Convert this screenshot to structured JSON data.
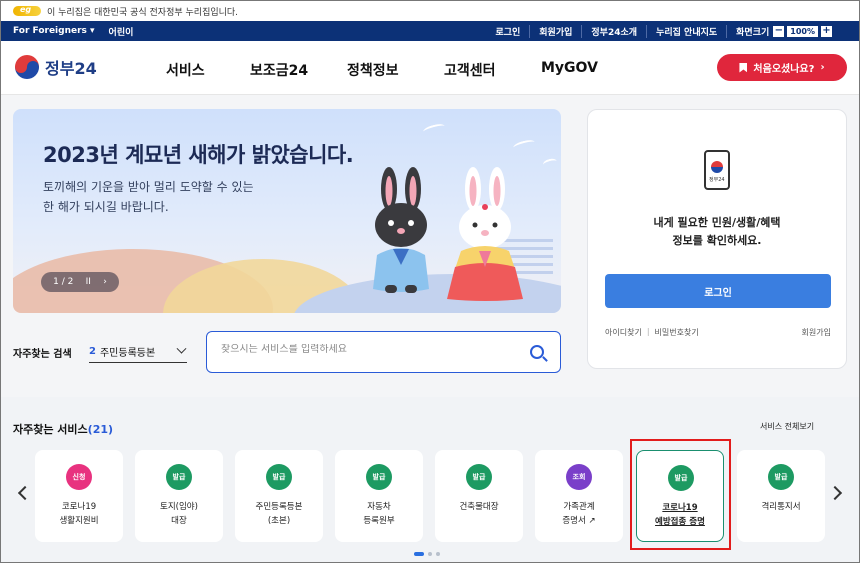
{
  "gov_strip": {
    "text": "이 누리집은 대한민국 공식 전자정부 누리집입니다."
  },
  "util_bar": {
    "for_foreigners": "For Foreigners",
    "kids": "어린이",
    "links": [
      "로그인",
      "회원가입",
      "정부24소개",
      "누리집 안내지도"
    ],
    "zoom_label": "화면크기",
    "zoom_minus": "−",
    "zoom_value": "100%",
    "zoom_plus": "+"
  },
  "header": {
    "logo_text": "정부24",
    "nav": [
      "서비스",
      "보조금24",
      "정책정보",
      "고객센터",
      "MyGOV"
    ],
    "first_visit_button": "처음오셨나요?",
    "first_visit_arrow": "›"
  },
  "banner": {
    "title": "2023년 계묘년 새해가 밝았습니다.",
    "subtitle_line1": "토끼해의 기운을 받아 멀리 도약할 수 있는",
    "subtitle_line2": "한 해가 되시길 바랍니다.",
    "pager": "1 / 2",
    "pager_pause": "II",
    "pager_next": "›"
  },
  "login_card": {
    "phone_text": "정부24",
    "message_line1": "내게 필요한 민원/생활/혜택",
    "message_line2": "정보를 확인하세요.",
    "login_button": "로그인",
    "find_id": "아이디찾기",
    "find_pw": "비밀번호찾기",
    "join": "회원가입"
  },
  "search": {
    "label": "자주찾는 검색",
    "selected_num": "2",
    "selected_value": "주민등록등본",
    "placeholder": "찾으시는 서비스를 입력하세요"
  },
  "services": {
    "title": "자주찾는 서비스",
    "count": "(21)",
    "view_all": "서비스 전체보기",
    "items": [
      {
        "badge": "신청",
        "label": "코로나19\n생활지원비",
        "badge_color": "#e8327f"
      },
      {
        "badge": "발급",
        "label": "토지(임야)\n대장",
        "badge_color": "#1d9a62"
      },
      {
        "badge": "발급",
        "label": "주민등록등본\n(초본)",
        "badge_color": "#1d9a62"
      },
      {
        "badge": "발급",
        "label": "자동차\n등록원부",
        "badge_color": "#1d9a62"
      },
      {
        "badge": "발급",
        "label": "건축물대장",
        "badge_color": "#1d9a62"
      },
      {
        "badge": "조회",
        "label": "가족관계\n증명서 ↗",
        "badge_color": "#7a3fc9"
      },
      {
        "badge": "발급",
        "label": "코로나19\n예방접종 증명",
        "badge_color": "#1d9a62"
      },
      {
        "badge": "발급",
        "label": "격리통지서",
        "badge_color": "#1d9a62"
      }
    ]
  }
}
